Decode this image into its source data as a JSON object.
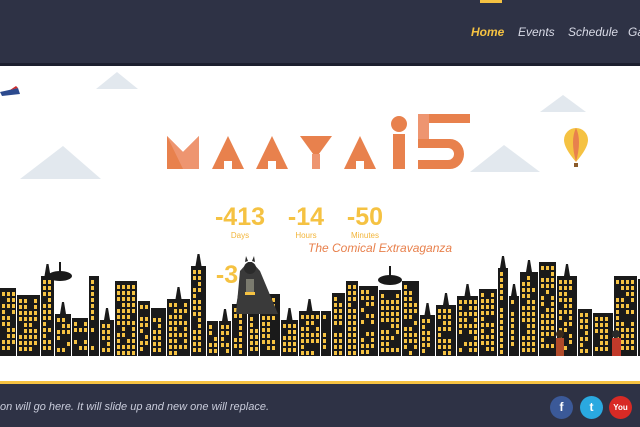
{
  "nav": {
    "items": [
      {
        "label": "Home",
        "active": true
      },
      {
        "label": "Events",
        "active": false
      },
      {
        "label": "Schedule",
        "active": false
      },
      {
        "label": "Ga",
        "active": false
      }
    ]
  },
  "hero": {
    "logo_text": "MAAYA",
    "logo_number": "15",
    "tagline": "The Comical Extravaganza"
  },
  "countdown": [
    {
      "value": "-413",
      "unit": "Days"
    },
    {
      "value": "-14",
      "unit": "Hours"
    },
    {
      "value": "-50",
      "unit": "Minutes"
    },
    {
      "value": "-3",
      "unit": ""
    }
  ],
  "footer": {
    "ticker": "on will go here. It will slide up and new one will replace."
  },
  "social": [
    {
      "name": "facebook",
      "glyph": "f",
      "color": "#3b5998"
    },
    {
      "name": "twitter",
      "glyph": "t",
      "color": "#2aa9e0"
    },
    {
      "name": "youtube",
      "glyph": "You",
      "color": "#d82a25"
    }
  ],
  "colors": {
    "header_bg": "#2e3245",
    "accent": "#f5c242",
    "logo_orange": "#e8814d",
    "building": "#1a1a1a",
    "window_yellow": "#f5c242"
  }
}
